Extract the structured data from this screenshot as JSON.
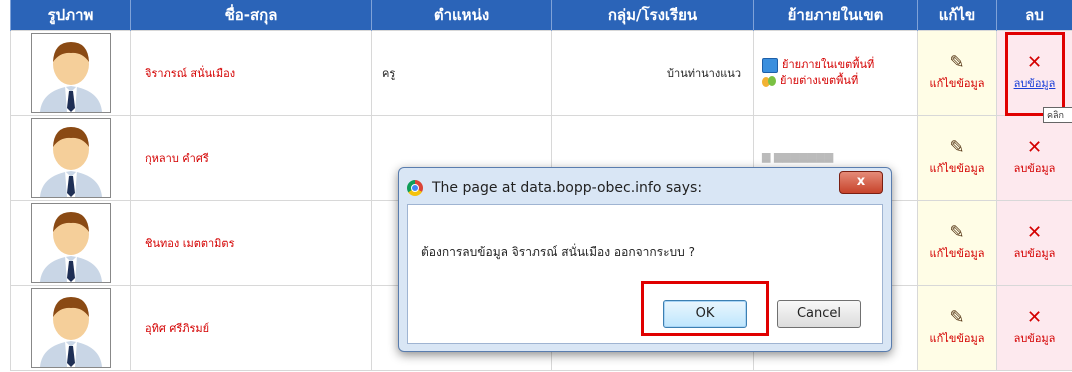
{
  "table": {
    "headers": [
      "รูปภาพ",
      "ชื่อ-สกุล",
      "ตำแหน่ง",
      "กลุ่ม/โรงเรียน",
      "ย้ายภายในเขต",
      "แก้ไข",
      "ลบ"
    ],
    "rows": [
      {
        "name": "จิราภรณ์ สนั่นเมือง",
        "position": "ครู",
        "school": "บ้านท่านางแนว",
        "move_in": "ย้ายภายในเขตพื้นที่",
        "move_out": "ย้ายต่างเขตพื้นที่",
        "edit": "แก้ไขข้อมูล",
        "delete": "ลบข้อมูล"
      },
      {
        "name": "กุหลาบ คำศรี",
        "position": "",
        "school": "",
        "move_in": "",
        "move_out": "",
        "edit": "แก้ไขข้อมูล",
        "delete": "ลบข้อมูล"
      },
      {
        "name": "ชินทอง เมตตามิตร",
        "position": "",
        "school": "",
        "move_in": "",
        "move_out": "",
        "edit": "แก้ไขข้อมูล",
        "delete": "ลบข้อมูล"
      },
      {
        "name": "อุทิศ ศรีภิรมย์",
        "position": "",
        "school": "",
        "move_in": "",
        "move_out": "",
        "edit": "แก้ไขข้อมูล",
        "delete": "ลบข้อมูล"
      }
    ]
  },
  "tooltip": "คลิก",
  "dialog": {
    "title": "The page at data.bopp-obec.info says:",
    "message": "ต้องการลบข้อมูล  จิราภรณ์ สนั่นเมือง ออกจากระบบ ?",
    "ok_label": "OK",
    "cancel_label": "Cancel",
    "close_label": "x"
  },
  "icons": {
    "avatar": "user-avatar-icon",
    "edit": "pencil-icon",
    "delete": "x-icon"
  },
  "colors": {
    "header_bg": "#2b64b8",
    "name_text": "#d40000",
    "edit_bg": "#fffde6",
    "delete_bg": "#fde9ee",
    "highlight": "#e00000"
  }
}
